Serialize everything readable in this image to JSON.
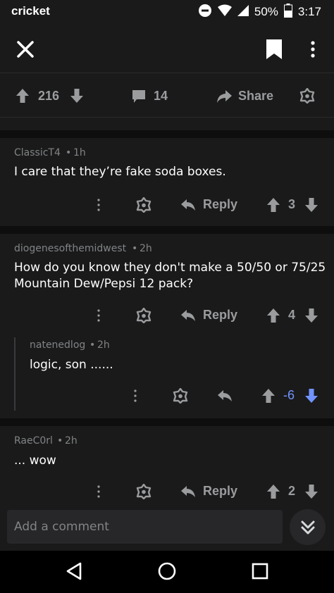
{
  "status_bar": {
    "carrier": "cricket",
    "battery": "50%",
    "time": "3:17"
  },
  "post": {
    "upvotes": "216",
    "comments": "14",
    "share_label": "Share"
  },
  "comments": [
    {
      "author": "ClassicT4",
      "age": "1h",
      "text": "I care that they’re fake soda boxes.",
      "reply_label": "Reply",
      "score": "3"
    },
    {
      "author": "diogenesofthemidwest",
      "age": "2h",
      "text_line1": "How do you know they don't make a 50/50 or 75/25",
      "text_line2": "Mountain Dew/Pepsi 12 pack?",
      "reply_label": "Reply",
      "score": "4"
    },
    {
      "author": "natenedlog",
      "age": "2h",
      "text": "logic, son ......",
      "score": "-6",
      "score_color": "#7193ff"
    },
    {
      "author": "RaeC0rl",
      "age": "2h",
      "text": "... wow",
      "reply_label": "Reply",
      "score": "2"
    }
  ],
  "composer": {
    "placeholder": "Add a comment"
  },
  "colors": {
    "background": "#1a1a1b",
    "separator": "#0e0e0f",
    "icon_gray": "#9a9c9e",
    "downvote_active": "#7193ff"
  },
  "icons": [
    "close-icon",
    "bookmark-icon",
    "more-vertical-icon",
    "upvote-icon",
    "downvote-icon",
    "comment-icon",
    "share-icon",
    "award-icon",
    "reply-icon",
    "jump-down-icon",
    "nav-back-icon",
    "nav-home-icon",
    "nav-recents-icon",
    "wifi-icon",
    "signal-icon",
    "battery-icon",
    "dnd-icon"
  ]
}
